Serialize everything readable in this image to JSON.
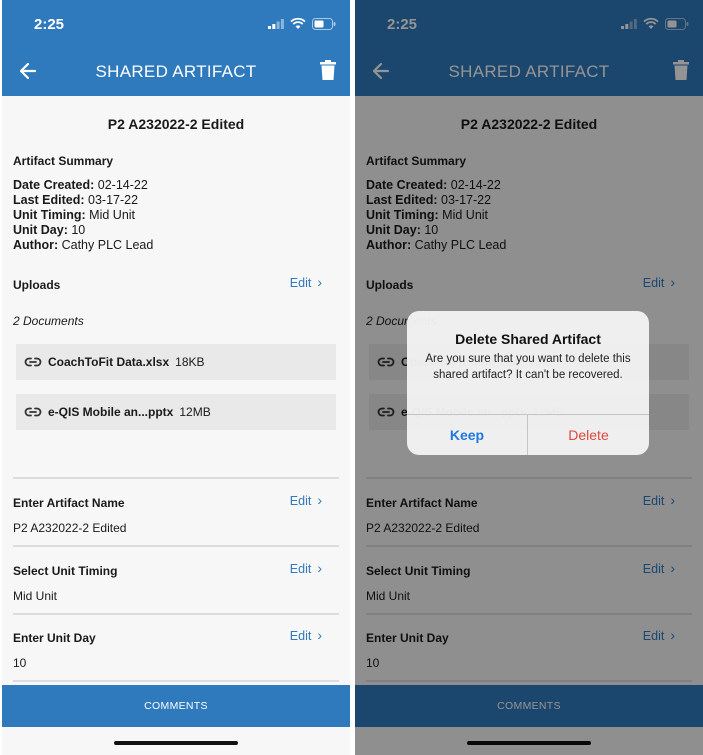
{
  "status": {
    "time": "2:25"
  },
  "appbar": {
    "title": "SHARED ARTIFACT"
  },
  "artifact": {
    "title": "P2 A232022-2 Edited",
    "summary_heading": "Artifact Summary",
    "meta": [
      {
        "label": "Date Created:",
        "value": "02-14-22"
      },
      {
        "label": "Last Edited:",
        "value": "03-17-22"
      },
      {
        "label": "Unit Timing:",
        "value": "Mid Unit"
      },
      {
        "label": "Unit Day:",
        "value": "10"
      },
      {
        "label": "Author:",
        "value": "Cathy PLC Lead"
      }
    ]
  },
  "uploads": {
    "heading": "Uploads",
    "edit_label": "Edit",
    "count_label": "2 Documents",
    "files": [
      {
        "name": "CoachToFit Data.xlsx",
        "size": "18KB"
      },
      {
        "name": "e-QIS Mobile an...pptx",
        "size": "12MB"
      }
    ]
  },
  "fields": [
    {
      "heading": "Enter Artifact Name",
      "value": "P2 A232022-2 Edited",
      "edit_label": "Edit"
    },
    {
      "heading": "Select Unit Timing",
      "value": "Mid Unit",
      "edit_label": "Edit"
    },
    {
      "heading": "Enter Unit Day",
      "value": "10",
      "edit_label": "Edit"
    }
  ],
  "footer": {
    "comments_label": "COMMENTS"
  },
  "dialog": {
    "title": "Delete Shared Artifact",
    "message": "Are you sure that you want to delete this shared artifact? It can't be recovered.",
    "keep_label": "Keep",
    "delete_label": "Delete"
  },
  "colors": {
    "primary": "#2f79bd",
    "keep": "#1e78e0",
    "delete": "#e0473d"
  }
}
